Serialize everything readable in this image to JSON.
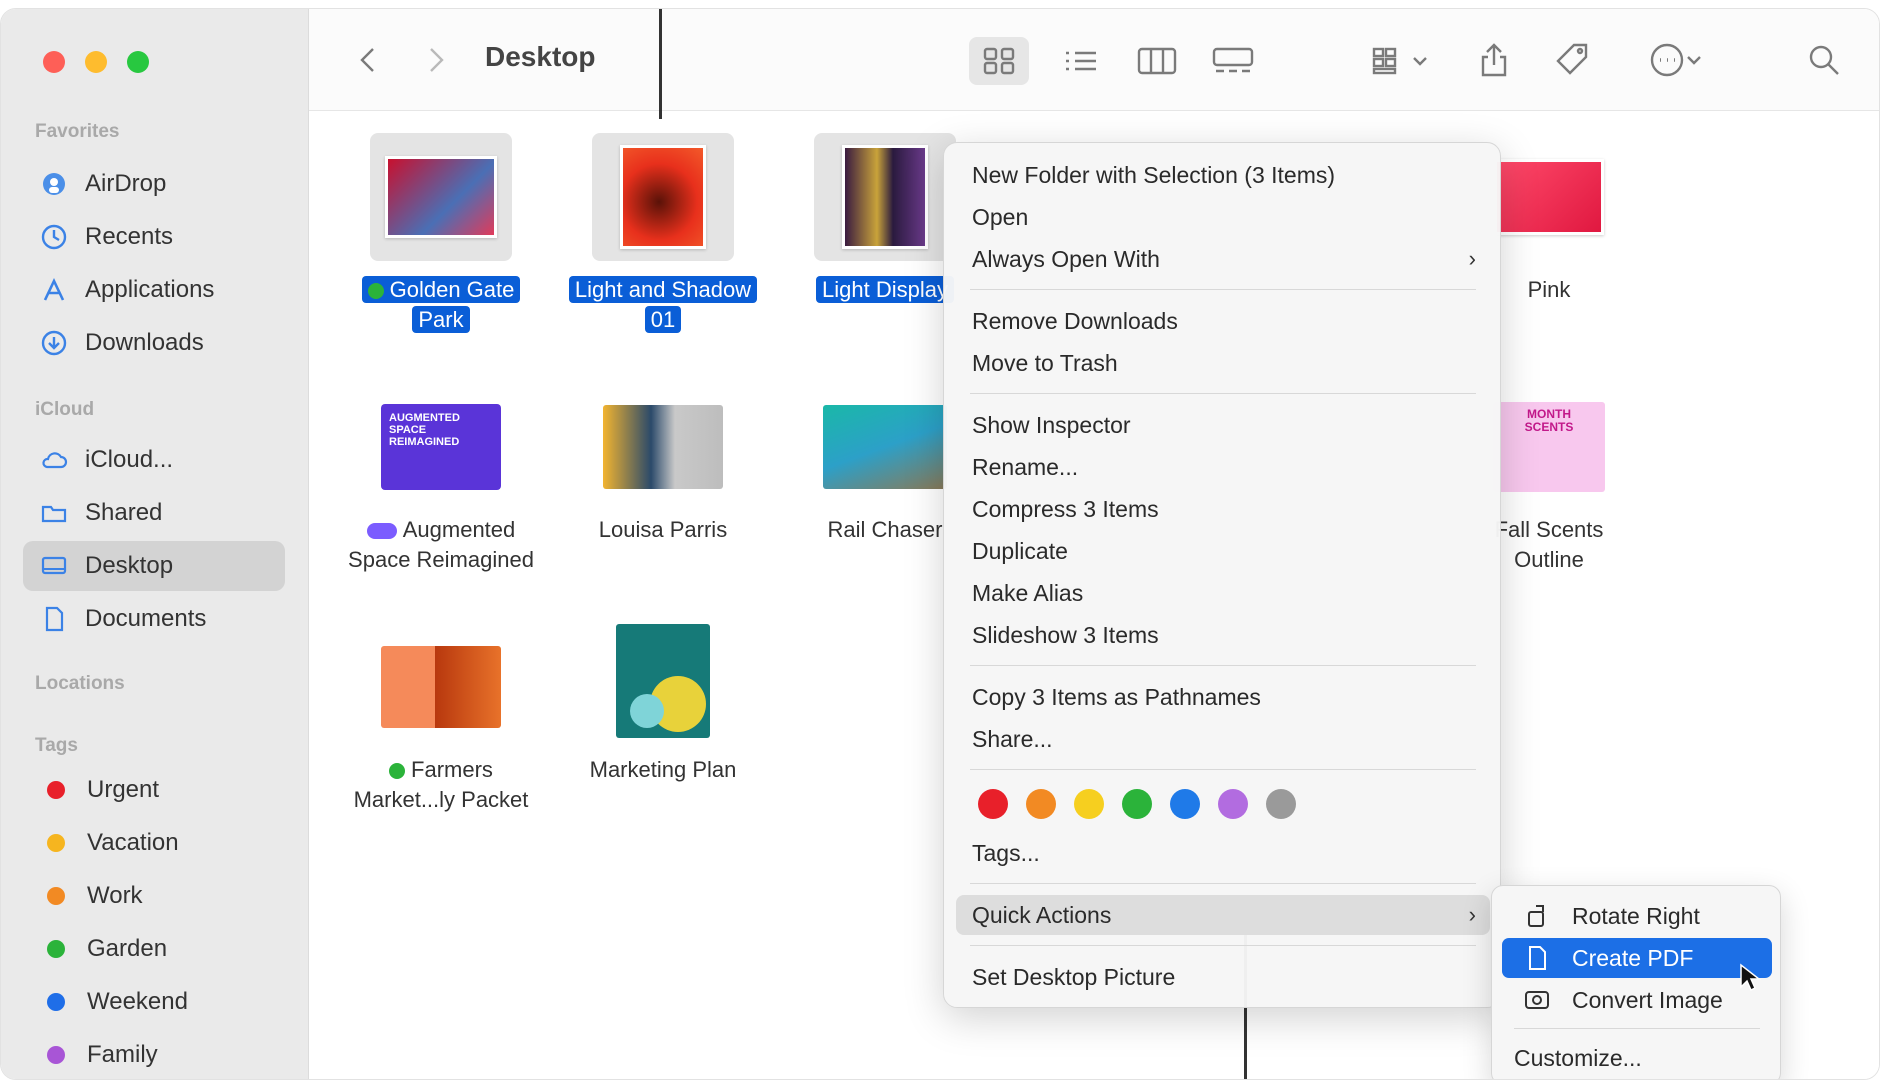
{
  "window": {
    "title": "Desktop"
  },
  "sidebar": {
    "favorites_label": "Favorites",
    "favorites": [
      {
        "label": "AirDrop",
        "icon": "airdrop-icon"
      },
      {
        "label": "Recents",
        "icon": "clock-icon"
      },
      {
        "label": "Applications",
        "icon": "applications-icon"
      },
      {
        "label": "Downloads",
        "icon": "download-icon"
      }
    ],
    "icloud_label": "iCloud",
    "icloud": [
      {
        "label": "iCloud...",
        "icon": "cloud-icon"
      },
      {
        "label": "Shared",
        "icon": "shared-folder-icon"
      },
      {
        "label": "Desktop",
        "icon": "desktop-icon",
        "active": true
      },
      {
        "label": "Documents",
        "icon": "document-icon"
      }
    ],
    "locations_label": "Locations",
    "tags_label": "Tags",
    "tags": [
      {
        "label": "Urgent",
        "color": "#e8202a"
      },
      {
        "label": "Vacation",
        "color": "#f6b51f"
      },
      {
        "label": "Work",
        "color": "#f28a23"
      },
      {
        "label": "Garden",
        "color": "#2bb33a"
      },
      {
        "label": "Weekend",
        "color": "#1f6ee8"
      },
      {
        "label": "Family",
        "color": "#a855d6"
      }
    ]
  },
  "files": [
    {
      "name_line1": "Golden Gate",
      "name_line2": "Park",
      "selected": true,
      "tag_color": "#2bb33a"
    },
    {
      "name_line1": "Light and Shadow",
      "name_line2": "01",
      "selected": true
    },
    {
      "name_line1": "Light Display",
      "name_line2": "",
      "selected": true
    },
    {
      "name_line1": "Pink",
      "name_line2": ""
    },
    {
      "name_line1": "Augmented",
      "name_line2": "Space Reimagined",
      "tag_color": "#7b5cff"
    },
    {
      "name_line1": "Louisa Parris",
      "name_line2": ""
    },
    {
      "name_line1": "Rail Chaser",
      "name_line2": ""
    },
    {
      "name_line1": "Fall Scents",
      "name_line2": "Outline"
    },
    {
      "name_line1": "Farmers",
      "name_line2": "Market...ly Packet",
      "tag_color": "#2bb33a"
    },
    {
      "name_line1": "Marketing Plan",
      "name_line2": ""
    }
  ],
  "context_menu": {
    "items": [
      "New Folder with Selection (3 Items)",
      "Open",
      "Always Open With",
      "Remove Downloads",
      "Move to Trash",
      "Show Inspector",
      "Rename...",
      "Compress 3 Items",
      "Duplicate",
      "Make Alias",
      "Slideshow 3 Items",
      "Copy 3 Items as Pathnames",
      "Share...",
      "Tags...",
      "Quick Actions",
      "Set Desktop Picture"
    ],
    "tag_colors": [
      "#e8202a",
      "#f28a23",
      "#f6cf1f",
      "#2bb33a",
      "#1f7ae8",
      "#b26ce0",
      "#9a9a9a"
    ]
  },
  "submenu": {
    "items": [
      "Rotate Right",
      "Create PDF",
      "Convert Image",
      "Customize..."
    ]
  }
}
